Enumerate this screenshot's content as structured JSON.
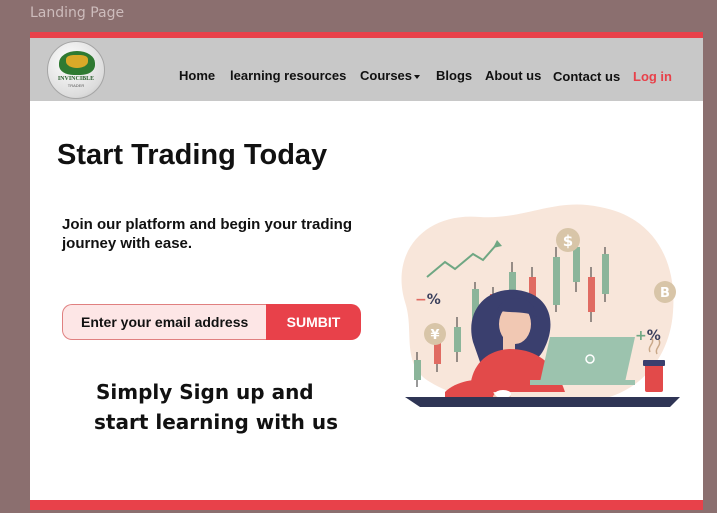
{
  "frame": {
    "label": "Landing Page"
  },
  "logo": {
    "name": "INVINCIBLE",
    "sub": "TRADER"
  },
  "nav": {
    "items": [
      {
        "id": "home",
        "label": "Home"
      },
      {
        "id": "learning",
        "label": "learning resources"
      },
      {
        "id": "courses",
        "label": "Courses"
      },
      {
        "id": "blogs",
        "label": "Blogs"
      },
      {
        "id": "about",
        "label": "About us"
      },
      {
        "id": "contact",
        "label": "Contact us"
      }
    ],
    "login": "Log in"
  },
  "hero": {
    "title": "Start Trading Today",
    "subtitle": "Join our platform and begin your trading journey with ease.",
    "email_placeholder": "Enter your email address",
    "submit_label": "SUMBIT",
    "tagline_line1": "Simply Sign up and",
    "tagline_line2": "start learning with us"
  },
  "illustration": {
    "symbols": [
      "$",
      "B",
      "¥",
      "−%",
      "+%"
    ],
    "icons": [
      "woman-laptop-illustration",
      "candlestick-chart-icon",
      "coffee-cup-icon",
      "trend-up-arrow-icon",
      "trend-down-arrow-icon"
    ]
  },
  "colors": {
    "accent": "#e8414a",
    "navbar": "#c8c8c8",
    "frame": "#8b6f6f"
  }
}
